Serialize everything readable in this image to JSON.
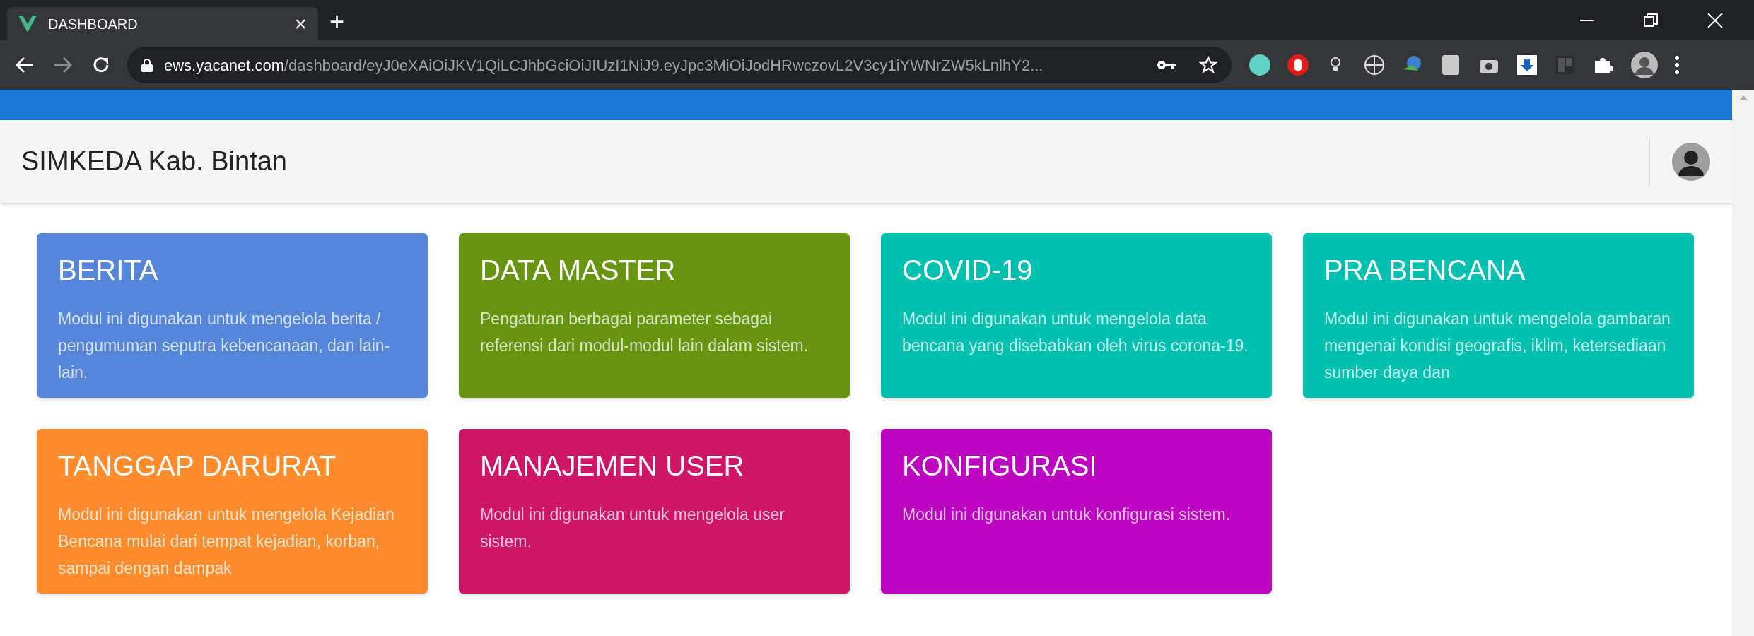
{
  "browser": {
    "tab": {
      "title": "DASHBOARD",
      "close": "×",
      "selected": true
    },
    "new_tab": "+",
    "url": {
      "host": "ews.yacanet.com",
      "path": "/dashboard/eyJ0eXAiOiJKV1QiLCJhbGciOiJIUzI1NiJ9.eyJpc3MiOiJodHRwczovL2V3cy1iYWNrZW5kLnlhY2..."
    }
  },
  "app_bar": {
    "title": "SIMKEDA Kab. Bintan"
  },
  "modules": [
    {
      "title": "BERITA",
      "description": "Modul ini digunakan untuk mengelola berita / pengumuman seputra kebencanaan, dan lain-lain.",
      "color": "#5586d9"
    },
    {
      "title": "DATA MASTER",
      "description": "Pengaturan berbagai parameter sebagai referensi dari modul-modul lain dalam sistem.",
      "color": "#679510"
    },
    {
      "title": "COVID-19",
      "description": "Modul ini digunakan untuk mengelola data bencana yang disebabkan oleh virus corona-19.",
      "color": "#00c1b0"
    },
    {
      "title": "PRA BENCANA",
      "description": "Modul ini digunakan untuk mengelola gambaran mengenai kondisi geografis, iklim, ketersediaan sumber daya dan",
      "color": "#00c1b0"
    },
    {
      "title": "TANGGAP DARURAT",
      "description": "Modul ini digunakan untuk mengelola Kejadian Bencana mulai dari tempat kejadian, korban, sampai dengan dampak",
      "color": "#ff8c2c"
    },
    {
      "title": "MANAJEMEN USER",
      "description": "Modul ini digunakan untuk mengelola user sistem.",
      "color": "#cf1568"
    },
    {
      "title": "KONFIGURASI",
      "description": "Modul ini digunakan untuk konfigurasi sistem.",
      "color": "#bc05c1"
    }
  ]
}
